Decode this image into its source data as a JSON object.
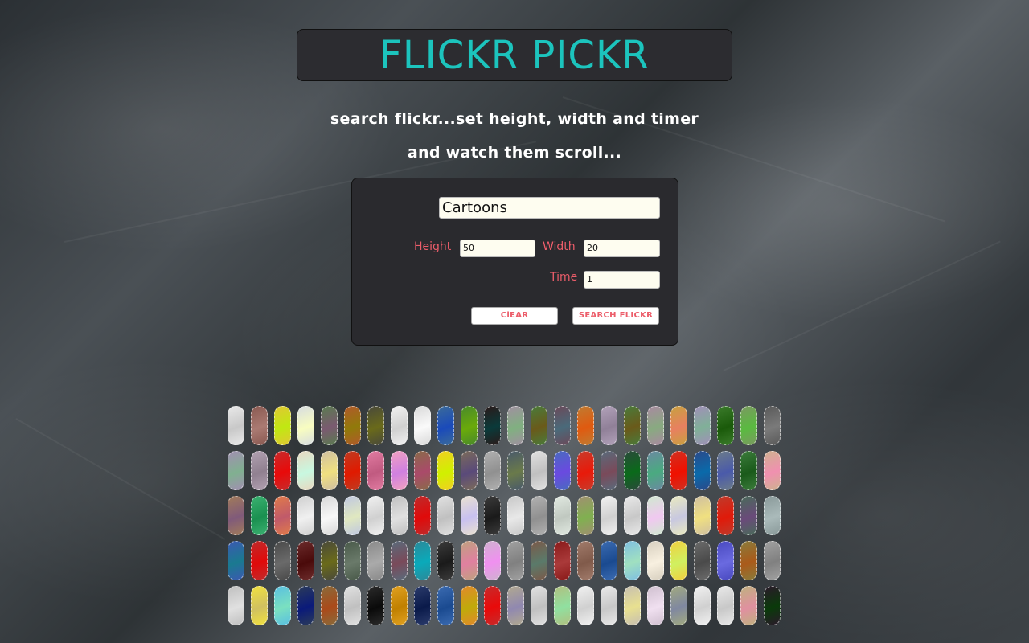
{
  "header": {
    "title": "FLICKR PICKR"
  },
  "intro": {
    "line1": "search flickr...set height, width and timer",
    "line2": "and watch them scroll..."
  },
  "form": {
    "search_value": "Cartoons",
    "height_label": "Height",
    "height_value": "50",
    "width_label": "Width",
    "width_value": "20",
    "time_label": "Time",
    "time_value": "1",
    "clear_label": "ClEAR",
    "search_label": "SEARCH FLICKR"
  },
  "colors": {
    "title": "#1cc4bd",
    "label": "#ec5d6a",
    "panel": "#2a2a2e"
  },
  "gallery": {
    "rows": 5,
    "cols": 24,
    "tiles": [
      [
        "#e8e8e8",
        "#8a5a52",
        "#e0c832",
        "#d8dde0",
        "#5a7a50",
        "#b05a2a",
        "#4a4a3a",
        "#f0f0f0",
        "#dadada",
        "#3a6a9a",
        "#4a8a2a",
        "#2a1a1a",
        "#a090a0",
        "#4a7a3a",
        "#6a4a5a",
        "#c07a30",
        "#b0a0b8",
        "#4a7a3a",
        "#a88aa0",
        "#c8a040",
        "#a090b8",
        "#3a7a2a",
        "#7a9a60",
        "#5a5a5a"
      ],
      [
        "#a090b0",
        "#b0a0b0",
        "#c82a2a",
        "#e8d8c0",
        "#d0c0a0",
        "#c03a20",
        "#e07aa0",
        "#f0a0c0",
        "#8a6a4a",
        "#f0d020",
        "#7a6a5a",
        "#b0b0b0",
        "#4a5a6a",
        "#e0e0e0",
        "#4a6ac0",
        "#c83a2a",
        "#5a6a7a",
        "#2a4a3a",
        "#6a8aa0",
        "#d03020",
        "#2a4a8a",
        "#6a7a8a",
        "#3a7a3a",
        "#d0b090"
      ],
      [
        "#a07a5a",
        "#3ab070",
        "#e07a4a",
        "#d0d0d0",
        "#d8d8d8",
        "#c0c8e0",
        "#f0f0f0",
        "#c0c0c0",
        "#c02a2a",
        "#e0e0e0",
        "#e8e0d0",
        "#3a3a3a",
        "#c8c8c8",
        "#b0b0b0",
        "#e0e8e0",
        "#a09070",
        "#f0f0f0",
        "#e8e8e8",
        "#d0e8d0",
        "#e8e8c0",
        "#d0c0a0",
        "#c03a2a",
        "#4a6a5a",
        "#8a9a9a"
      ],
      [
        "#3a5ab0",
        "#c02a2a",
        "#4a4a4a",
        "#6a2a2a",
        "#4a4a3a",
        "#4a5a4a",
        "#8a8a8a",
        "#5a6a7a",
        "#2a8a9a",
        "#3a3a3a",
        "#c0a080",
        "#d0b0d0",
        "#a0a0a0",
        "#7a5a4a",
        "#8a1a1a",
        "#a07a6a",
        "#3a6ab0",
        "#80c0e0",
        "#d8d0c0",
        "#f0d040",
        "#6a6a6a",
        "#4a4ac0",
        "#8a7a3a",
        "#a0a0a0"
      ],
      [
        "#c0c0c0",
        "#f0e040",
        "#5ac0e0",
        "#2a3a5a",
        "#8a6a3a",
        "#e0e0e0",
        "#2a2a2a",
        "#e0a020",
        "#2a3a6a",
        "#3a6ab0",
        "#e08a2a",
        "#c82a2a",
        "#b0a890",
        "#e0e0e0",
        "#b0c080",
        "#f0f0f0",
        "#e8e8e8",
        "#c8c0b0",
        "#d0c0d0",
        "#a0a880",
        "#f0f0f0",
        "#e8e8e8",
        "#c0b080",
        "#2a1a2a"
      ]
    ]
  }
}
